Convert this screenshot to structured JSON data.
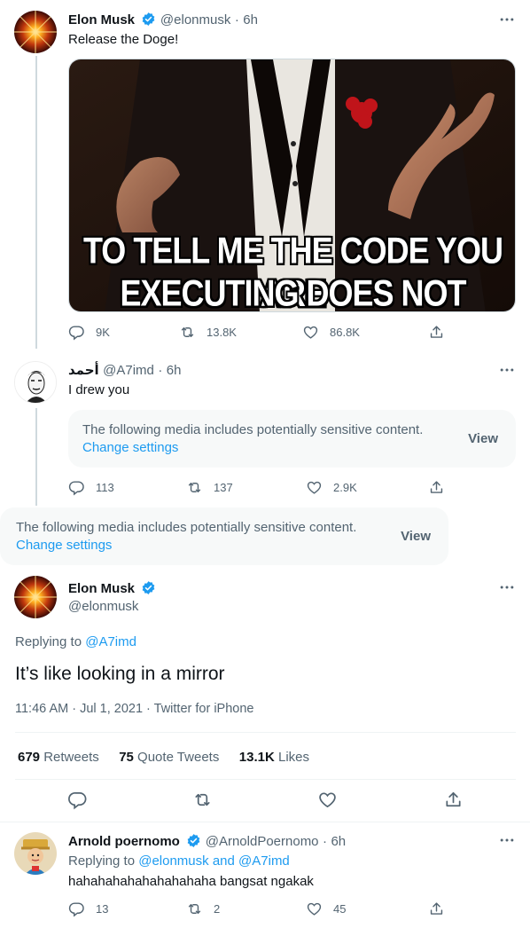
{
  "tweet1": {
    "name": "Elon Musk",
    "handle": "@elonmusk",
    "time": "6h",
    "text": "Release the Doge!",
    "meme_line1": "TO TELL ME THE CODE YOU ARE",
    "meme_line2": "EXECUTING DOES NOT COMPILE",
    "replies": "9K",
    "retweets": "13.8K",
    "likes": "86.8K"
  },
  "tweet2": {
    "name": "أحمد",
    "handle": "@A7imd",
    "time": "6h",
    "text": "I drew you",
    "sensitive_text": "The following media includes potentially sensitive content.",
    "change_settings": "Change settings",
    "view": "View",
    "replies": "113",
    "retweets": "137",
    "likes": "2.9K"
  },
  "sensitive_banner": {
    "text": "The following media includes potentially sensitive content.",
    "change_settings": "Change settings",
    "view": "View"
  },
  "main_tweet": {
    "name": "Elon Musk",
    "handle": "@elonmusk",
    "replying_label": "Replying to",
    "replying_to": "@A7imd",
    "text": "It’s like looking in a mirror",
    "timestamp": "11:46 AM · Jul 1, 2021 · Twitter for iPhone",
    "retweets_count": "679",
    "retweets_label": "Retweets",
    "quotes_count": "75",
    "quotes_label": "Quote Tweets",
    "likes_count": "13.1K",
    "likes_label": "Likes"
  },
  "reply": {
    "name": "Arnold poernomo",
    "handle": "@ArnoldPoernomo",
    "time": "6h",
    "replying_label": "Replying to",
    "replying_to_1": "@elonmusk",
    "and": "and",
    "replying_to_2": "@A7imd",
    "text": "hahahahahahahahahaha bangsat ngakak",
    "replies": "13",
    "retweets": "2",
    "likes": "45"
  },
  "separator": "·",
  "colors": {
    "accent": "#1d9bf0",
    "muted": "#536471",
    "text": "#0f1419",
    "border": "#eff3f4",
    "sensitive_bg": "#f7f9f9"
  }
}
